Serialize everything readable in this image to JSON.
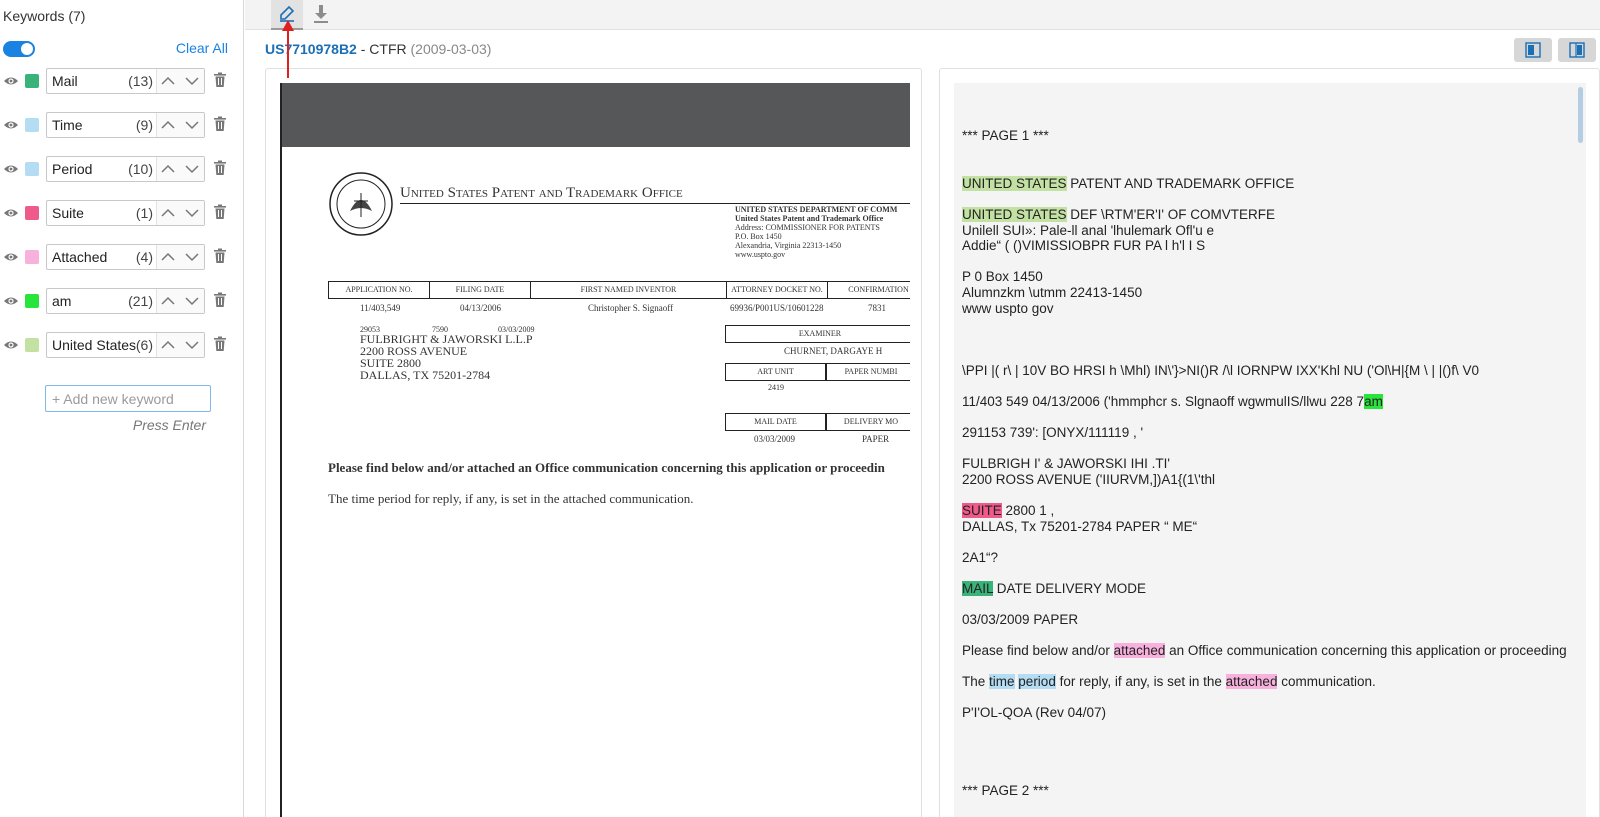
{
  "sidebar": {
    "title": "Keywords (7)",
    "clear_all": "Clear All",
    "keywords": [
      {
        "label": "Mail",
        "count": "(13)",
        "color": "#3ab37a"
      },
      {
        "label": "Time",
        "count": "(9)",
        "color": "#b4dcf3"
      },
      {
        "label": "Period",
        "count": "(10)",
        "color": "#b4dcf3"
      },
      {
        "label": "Suite",
        "count": "(1)",
        "color": "#ee5a8a"
      },
      {
        "label": "Attached",
        "count": "(4)",
        "color": "#f7b1dc"
      },
      {
        "label": "am",
        "count": "(21)",
        "color": "#28e43c"
      },
      {
        "label": "United States",
        "count": "(6)",
        "color": "#c4e1a4"
      }
    ],
    "new_keyword_placeholder": "+ Add new keyword",
    "press_enter": "Press Enter"
  },
  "toolbar": {
    "highlight_icon": "highlighter-icon",
    "download_icon": "download-icon"
  },
  "document": {
    "number": "US7710978B2",
    "type": " - CTFR ",
    "date": "(2009-03-03)"
  },
  "scan": {
    "office_name": "United States Patent and Trademark Office",
    "dept_lines": [
      "UNITED STATES DEPARTMENT OF COMM",
      "United States Patent and Trademark Office",
      "Address: COMMISSIONER FOR PATENTS",
      "P.O. Box 1450",
      "Alexandria, Virginia 22313-1450",
      "www.uspto.gov"
    ],
    "table_headers": [
      "APPLICATION NO.",
      "FILING DATE",
      "FIRST NAMED INVENTOR",
      "ATTORNEY DOCKET NO.",
      "CONFIRMATION"
    ],
    "table_values": [
      "11/403,549",
      "04/13/2006",
      "Christopher S. Signaoff",
      "69936/P001US/10601228",
      "7831"
    ],
    "codes": [
      "29053",
      "7590",
      "03/03/2009"
    ],
    "address": "FULBRIGHT & JAWORSKI L.L.P\n2200 ROSS AVENUE\nSUITE 2800\nDALLAS, TX 75201-2784",
    "examiner_label": "EXAMINER",
    "examiner_name": "CHURNET, DARGAYE H",
    "art_unit_label": "ART UNIT",
    "paper_number_label": "PAPER NUMBI",
    "art_unit_value": "2419",
    "mail_date_label": "MAIL DATE",
    "delivery_mode_label": "DELIVERY MO",
    "mail_date_value": "03/03/2009",
    "delivery_mode_value": "PAPER",
    "para1": "Please find below and/or attached an Office communication concerning this application or proceedin",
    "para2": "The time period for reply, if any, is set in the attached communication."
  },
  "ocr": {
    "page1": "*** PAGE 1 ***",
    "l1_hl": "UNITED STATES",
    "l1_rest": " PATENT AND TRADEMARK OFFICE",
    "l2_hl": "UNITED STATES",
    "l2_rest": " DEF \\RTM'ER'I' OF COMVTERFE",
    "l3": "Unilell SUI»: Pale-ll anal 'lhulemark Ofl'u e",
    "l4": "Addie“ ( ()VIMISSIOBPR FUR PA l h'l I S",
    "l5": "P 0 Box 1450",
    "l6": "Alumnzkm \\utmm 22413-1450",
    "l7": "www uspto gov",
    "l8": "\\PPI |( r\\ | 10V BO HRSI h \\Mhl) IN\\'}>NI()R /\\l IORNPW IXX'Khl NU ('Ol\\H|{M \\ | |()f\\ V0",
    "l9_pre": "11/403 549 04/13/2006 ('hmmphcr s. Slgnaoff wgwmulIS/llwu 228 7",
    "l9_hl": "am",
    "l10": "291153 739': [ONYX/111119 , '",
    "l11": "FULBRIGH I' & JAWORSKI IHI .TI'",
    "l12": "2200 ROSS AVENUE ('IIURVM,])A1{(1\\'thl",
    "l13_hl": "SUITE",
    "l13_rest": " 2800 1 ,",
    "l14": "DALLAS, Tx 75201-2784 PAPER “ ME“",
    "l15": "2A1“?",
    "l16_hl": "MAIL",
    "l16_rest": " DATE DELIVERY MODE",
    "l17": "03/03/2009 PAPER",
    "l18_a": "Please find below and/or ",
    "l18_hl": "attached",
    "l18_b": " an Office communication concerning this application or proceeding",
    "l19_a": "The ",
    "l19_hl1": "time",
    "l19_sp": " ",
    "l19_hl2": "period",
    "l19_b": " for reply, if any, is set in the ",
    "l19_hl3": "attached",
    "l19_c": " communication.",
    "l20": "P'I'OL-QOA (Rev 04/07)",
    "page2": "*** PAGE 2 ***"
  }
}
